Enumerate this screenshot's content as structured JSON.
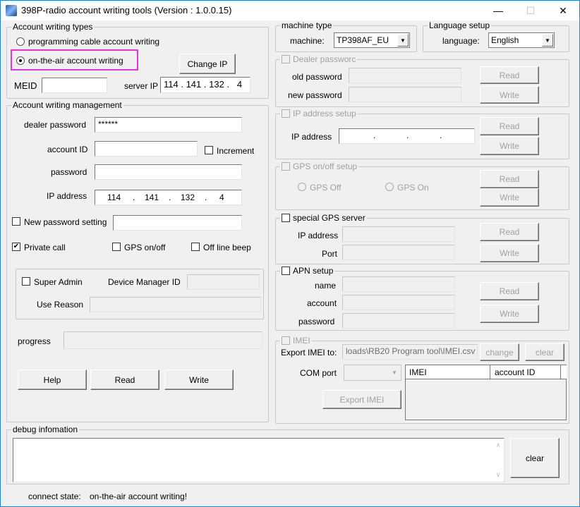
{
  "window": {
    "title": "398P-radio account writing tools (Version : 1.0.0.15)",
    "controls": {
      "minimize": "—",
      "maximize": "☐",
      "close": "✕"
    }
  },
  "account_types": {
    "legend": "Account writing types",
    "options": [
      {
        "label": "programming cable account writing",
        "selected": false
      },
      {
        "label": "on-the-air account writing",
        "selected": true
      }
    ],
    "change_ip_label": "Change IP",
    "meid_label": "MEID",
    "meid_value": "",
    "server_ip_label": "server IP",
    "server_ip": [
      "114",
      "141",
      "132",
      "4"
    ]
  },
  "management": {
    "legend": "Account writing management",
    "dealer_password_label": "dealer password",
    "dealer_password_value": "******",
    "account_id_label": "account ID",
    "account_id_value": "",
    "increment_label": "Increment",
    "increment_checked": false,
    "password_label": "password",
    "password_value": "",
    "ip_address_label": "IP address",
    "ip_address": [
      "114",
      "141",
      "132",
      "4"
    ],
    "new_password_label": "New password setting",
    "new_password_checked": false,
    "new_password_value": "",
    "private_call_label": "Private call",
    "private_call_checked": true,
    "gps_onoff_label": "GPS on/off",
    "gps_onoff_checked": false,
    "offline_beep_label": "Off line beep",
    "offline_beep_checked": false,
    "super_admin_label": "Super Admin",
    "super_admin_checked": false,
    "device_manager_id_label": "Device Manager ID",
    "device_manager_id_value": "",
    "use_reason_label": "Use Reason",
    "use_reason_value": "",
    "progress_label": "progress",
    "progress_percent": 0,
    "help_label": "Help",
    "read_label": "Read",
    "write_label": "Write"
  },
  "machine_type": {
    "legend": "machine type",
    "label": "machine:",
    "selected": "TP398AF_EU"
  },
  "language_setup": {
    "legend": "Language setup",
    "label": "language:",
    "selected": "English"
  },
  "dealer_password": {
    "legend": "Dealer passworc",
    "old_label": "old password",
    "new_label": "new password",
    "read_label": "Read",
    "write_label": "Write"
  },
  "ip_setup": {
    "legend": "IP address setup",
    "ip_label": "IP address",
    "read_label": "Read",
    "write_label": "Write"
  },
  "gps_setup": {
    "legend": "GPS on/off setup",
    "off_label": "GPS Off",
    "on_label": "GPS On",
    "read_label": "Read",
    "write_label": "Write"
  },
  "special_gps": {
    "legend": "special GPS server",
    "ip_label": "IP address",
    "port_label": "Port",
    "read_label": "Read",
    "write_label": "Write"
  },
  "apn_setup": {
    "legend": "APN setup",
    "name_label": "name",
    "account_label": "account",
    "password_label": "password",
    "read_label": "Read",
    "write_label": "Write"
  },
  "imei": {
    "legend": "IMEI",
    "export_to_label": "Export IMEI to:",
    "export_path": "loads\\RB20 Program tool\\IMEI.csv",
    "change_label": "change",
    "clear_label": "clear",
    "com_port_label": "COM port",
    "com_port_value": "",
    "export_button_label": "Export IMEI",
    "columns": [
      "IMEI",
      "account ID"
    ],
    "rows": []
  },
  "debug": {
    "legend": "debug infomation",
    "text": "",
    "clear_label": "clear"
  },
  "status": {
    "label": "connect state:",
    "value": "on-the-air account writing!"
  }
}
